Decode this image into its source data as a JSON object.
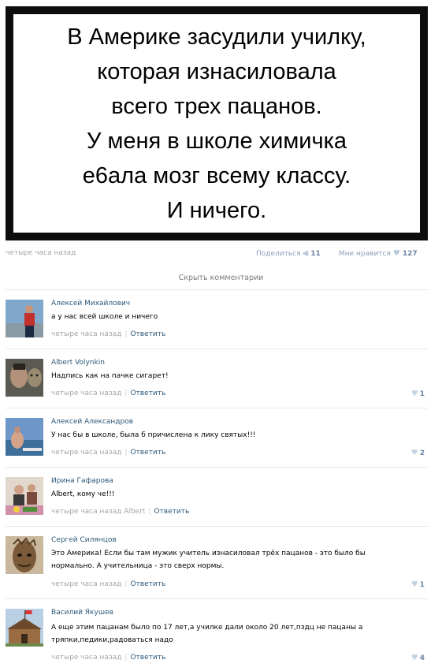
{
  "meme": {
    "lines": [
      "В Америке засудили училку,",
      "которая изнасиловала",
      "всего трех пацанов.",
      "У меня в школе химичка",
      "е6ала мозг всему классу.",
      "И ничего."
    ]
  },
  "post": {
    "time": "четыре часа назад",
    "share_label": "Поделиться",
    "share_count": "11",
    "like_label": "Мне нравится",
    "like_count": "127",
    "hide_comments": "Скрыть комментарии"
  },
  "colors": {
    "link": "#2b587a",
    "muted": "#a5a5a5",
    "divider": "#e4e8ed"
  },
  "comments": [
    {
      "author": "Алексей Михайлович",
      "text": "а у нас всей школе и ничего",
      "time": "четыре часа назад",
      "reply": "Ответить",
      "likes": ""
    },
    {
      "author": "Albert Volynkin",
      "text": "Надпись как на пачке сигарет!",
      "time": "четыре часа назад",
      "reply": "Ответить",
      "likes": "1"
    },
    {
      "author": "Алексей Александров",
      "text": "У нас бы в школе, была б причислена к лику святых!!!",
      "time": "четыре часа назад",
      "reply": "Ответить",
      "likes": "2"
    },
    {
      "author": "Ирина Гафарова",
      "text": "Albert, кому че!!!",
      "time": "четыре часа назад",
      "reply_to": "Albert",
      "reply": "Ответить",
      "likes": ""
    },
    {
      "author": "Сергей Силянцов",
      "text_lines": [
        "Это Америка! Если бы там мужик учитель изнасиловал трёх пацанов - это было бы",
        "нормально. А учительница - это сверх нормы."
      ],
      "time": "четыре часа назад",
      "reply": "Ответить",
      "likes": "1"
    },
    {
      "author": "Василий Якушев",
      "text_lines": [
        "А еще этим пацанам было по 17 лет,а училке дали около 20 лет,пздц не пацаны а",
        "тряпки,педики,радоваться надо"
      ],
      "time": "четыре часа назад",
      "reply": "Ответить",
      "likes": "4"
    }
  ]
}
